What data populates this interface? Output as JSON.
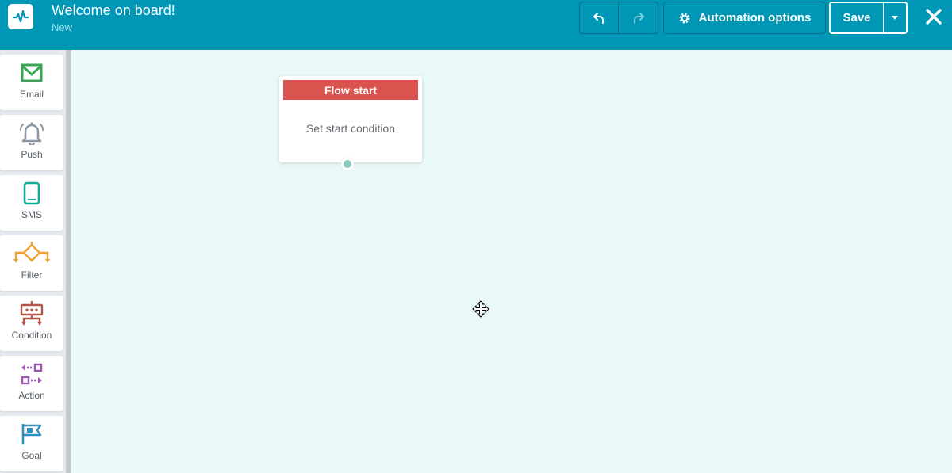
{
  "header": {
    "title": "Welcome on board!",
    "status": "New",
    "automation_options_label": "Automation options",
    "save_label": "Save"
  },
  "sidebar": {
    "items": [
      {
        "label": "Email",
        "icon": "email-icon",
        "color": "#3aa655"
      },
      {
        "label": "Push",
        "icon": "bell-icon",
        "color": "#8996a3"
      },
      {
        "label": "SMS",
        "icon": "mobile-icon",
        "color": "#16a99a"
      },
      {
        "label": "Filter",
        "icon": "filter-split-icon",
        "color": "#f0a030"
      },
      {
        "label": "Condition",
        "icon": "condition-icon",
        "color": "#b3554a"
      },
      {
        "label": "Action",
        "icon": "action-icon",
        "color": "#9b59b6"
      },
      {
        "label": "Goal",
        "icon": "goal-flag-icon",
        "color": "#2b8fc0"
      }
    ]
  },
  "canvas": {
    "node": {
      "title": "Flow start",
      "body": "Set start condition"
    }
  },
  "colors": {
    "header_bg": "#0096b5",
    "canvas_bg": "#e9f8f8",
    "node_header": "#d9534f"
  }
}
